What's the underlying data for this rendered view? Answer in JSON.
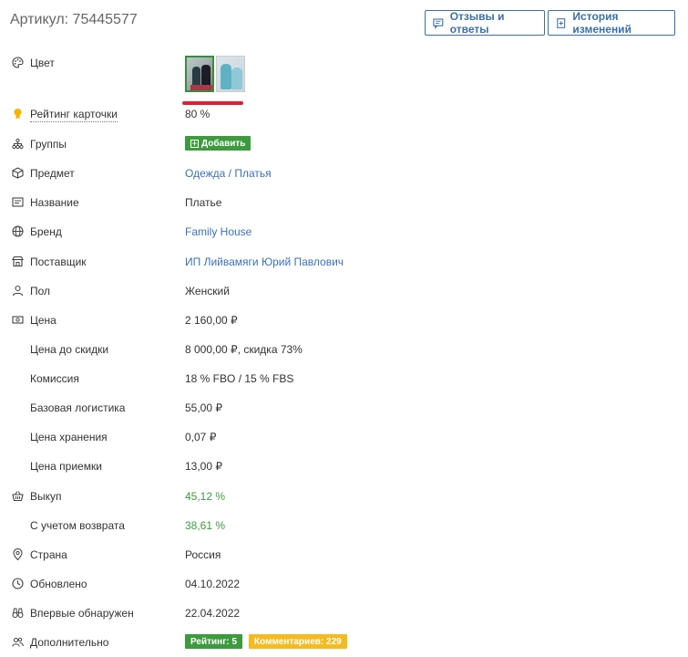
{
  "header": {
    "article": "Артикул: 75445577",
    "reviews_button": "Отзывы и ответы",
    "history_button": "История изменений"
  },
  "rows": {
    "color": {
      "label": "Цвет"
    },
    "rating": {
      "label": "Рейтинг карточки",
      "value": "80 %"
    },
    "groups": {
      "label": "Группы",
      "button": "Добавить"
    },
    "subject": {
      "label": "Предмет",
      "value": "Одежда / Платья"
    },
    "name": {
      "label": "Название",
      "value": "Платье"
    },
    "brand": {
      "label": "Бренд",
      "value": "Family House"
    },
    "supplier": {
      "label": "Поставщик",
      "value": "ИП Лийвамяги Юрий Павлович"
    },
    "gender": {
      "label": "Пол",
      "value": "Женский"
    },
    "price": {
      "label": "Цена",
      "value": "2 160,00 ₽"
    },
    "price_before_discount": {
      "label": "Цена до скидки",
      "value": "8 000,00 ₽, скидка 73%"
    },
    "commission": {
      "label": "Комиссия",
      "value": "18 % FBO / 15 % FBS"
    },
    "base_logistics": {
      "label": "Базовая логистика",
      "value": "55,00 ₽"
    },
    "storage_price": {
      "label": "Цена хранения",
      "value": "0,07 ₽"
    },
    "acceptance_price": {
      "label": "Цена приемки",
      "value": "13,00 ₽"
    },
    "buyout": {
      "label": "Выкуп",
      "value": "45,12 %"
    },
    "with_returns": {
      "label": "С учетом возврата",
      "value": "38,61 %"
    },
    "country": {
      "label": "Страна",
      "value": "Россия"
    },
    "updated": {
      "label": "Обновлено",
      "value": "04.10.2022"
    },
    "first_seen": {
      "label": "Впервые обнаружен",
      "value": "22.04.2022"
    },
    "additional": {
      "label": "Дополнительно",
      "rating_badge": "Рейтинг: 5",
      "comments_badge": "Комментариев: 229"
    }
  },
  "colors": {
    "accent_blue": "#3a72b8",
    "green": "#3d9a3d",
    "yellow": "#f4bb21",
    "red_underline": "#d9232e"
  }
}
